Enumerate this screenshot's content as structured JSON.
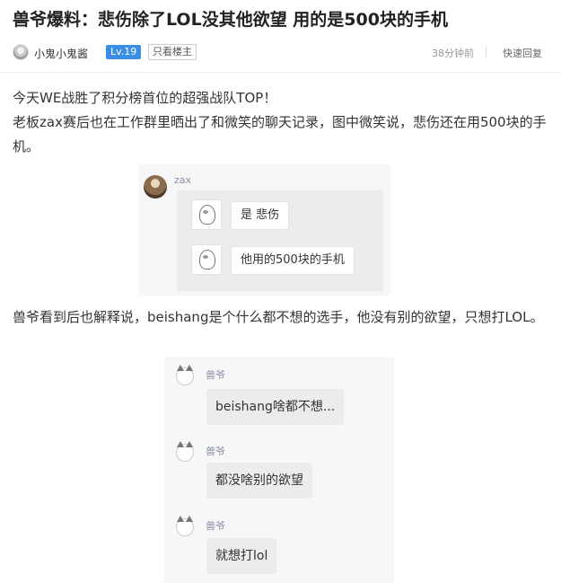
{
  "post": {
    "title": "兽爷爆料：悲伤除了LOL没其他欲望 用的是500块的手机",
    "author": "小鬼小鬼酱",
    "level": "Lv.19",
    "only_op": "只看楼主",
    "time": "38分钟前",
    "quick_reply": "快速回复"
  },
  "body": {
    "p1": "今天WE战胜了积分榜首位的超强战队TOP！",
    "p2": "老板zax赛后也在工作群里晒出了和微笑的聊天记录，图中微笑说，悲伤还在用500块的手机。",
    "p3": "兽爷看到后也解释说，beishang是个什么都不想的选手，他没有别的欲望，只想打LOL。"
  },
  "chat1": {
    "sender": "zax",
    "messages": [
      "是 悲伤",
      "他用的500块的手机"
    ]
  },
  "chat2": {
    "messages": [
      {
        "sender": "兽爷",
        "text": "beishang啥都不想..."
      },
      {
        "sender": "兽爷",
        "text": "都没啥别的欲望"
      },
      {
        "sender": "兽爷",
        "text": "就想打lol"
      }
    ]
  },
  "colors": {
    "level_badge": "#3a8ee6",
    "chat_name": "#8a8fa8"
  }
}
